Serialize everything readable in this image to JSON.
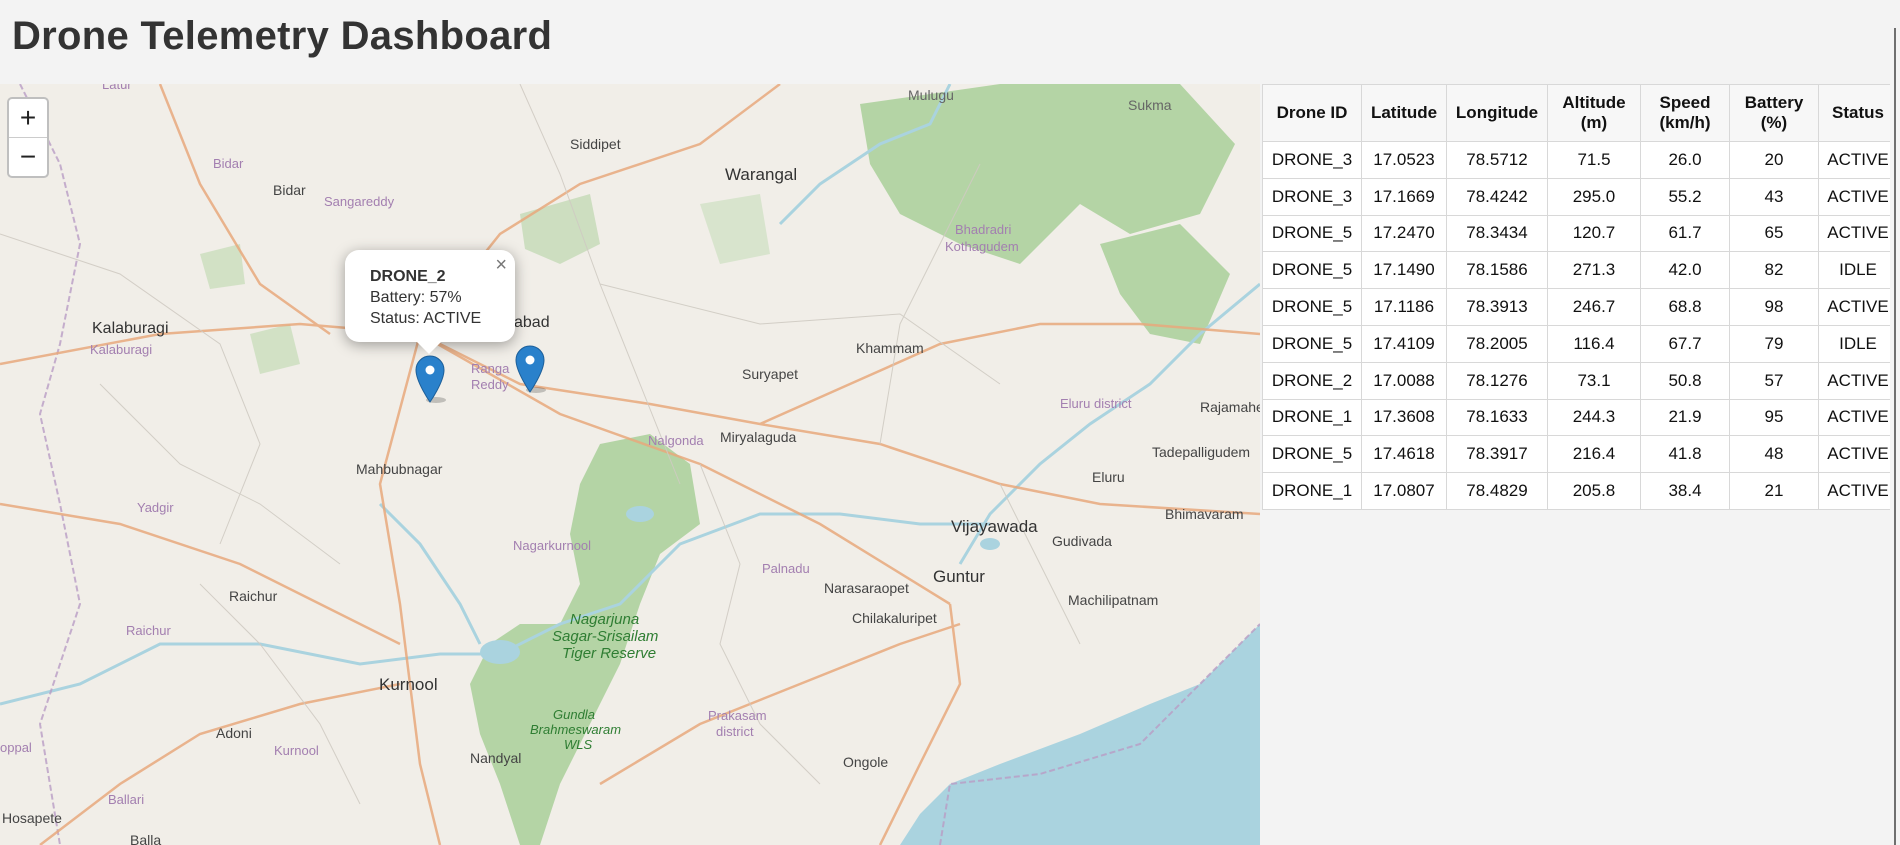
{
  "page": {
    "title": "Drone Telemetry Dashboard"
  },
  "map": {
    "zoom_in_label": "+",
    "zoom_out_label": "−",
    "labels": {
      "latur": "Latur",
      "mulugu": "Mulugu",
      "sukma": "Sukma",
      "bidar_ka": "Bidar",
      "bidar": "Bidar",
      "siddipet": "Siddipet",
      "sangareddy": "Sangareddy",
      "warangal": "Warangal",
      "bhadradri": "Bhadradri",
      "kothagudem": "Kothagudem",
      "kalaburagi": "Kalaburagi",
      "kalaburagi_dist": "Kalaburagi",
      "hyderabad_frag": "abad",
      "ranga": "Ranga",
      "reddy": "Reddy",
      "khammam": "Khammam",
      "suryapet": "Suryapet",
      "eluru_district": "Eluru district",
      "rajamahe": "Rajamahe",
      "nalgonda": "Nalgonda",
      "miryalaguda": "Miryalaguda",
      "mahbubnagar": "Mahbubnagar",
      "tadepalligudem": "Tadepalligudem",
      "eluru": "Eluru",
      "yadgir": "Yadgir",
      "bhimavaram": "Bhimavaram",
      "vijayawada": "Vijayawada",
      "nagarkurnool": "Nagarkurnool",
      "gudivada": "Gudivada",
      "palnadu": "Palnadu",
      "guntur": "Guntur",
      "raichur": "Raichur",
      "narasaraopet": "Narasaraopet",
      "machilipatnam": "Machilipatnam",
      "raichur_dist": "Raichur",
      "chilakaluripet": "Chilakaluripet",
      "nagarjuna1": "Nagarjuna",
      "nagarjuna2": "Sagar-Srisailam",
      "nagarjuna3": "Tiger Reserve",
      "kurnool": "Kurnool",
      "gundla1": "Gundla",
      "gundla2": "Brahmeswaram",
      "gundla3": "WLS",
      "prakasam1": "Prakasam",
      "prakasam2": "district",
      "adoni": "Adoni",
      "kurnool_dist": "Kurnool",
      "nandyal": "Nandyal",
      "koppal": "oppal",
      "ongole": "Ongole",
      "ballari": "Ballari",
      "hosapete": "Hosapete",
      "ballari_frag": "Balla"
    },
    "popup": {
      "title": "DRONE_2",
      "battery": "Battery: 57%",
      "status": "Status: ACTIVE",
      "close": "×"
    },
    "colors": {
      "marker": "#2a81cb",
      "water": "#aad3df",
      "forest": "#add19e"
    }
  },
  "table": {
    "headers": [
      [
        "Drone ID"
      ],
      [
        "Latitude"
      ],
      [
        "Longitude"
      ],
      [
        "Altitude",
        "(m)"
      ],
      [
        "Speed",
        "(km/h)"
      ],
      [
        "Battery",
        "(%)"
      ],
      [
        "Status"
      ]
    ],
    "rows": [
      [
        "DRONE_3",
        "17.0523",
        "78.5712",
        "71.5",
        "26.0",
        "20",
        "ACTIVE"
      ],
      [
        "DRONE_3",
        "17.1669",
        "78.4242",
        "295.0",
        "55.2",
        "43",
        "ACTIVE"
      ],
      [
        "DRONE_5",
        "17.2470",
        "78.3434",
        "120.7",
        "61.7",
        "65",
        "ACTIVE"
      ],
      [
        "DRONE_5",
        "17.1490",
        "78.1586",
        "271.3",
        "42.0",
        "82",
        "IDLE"
      ],
      [
        "DRONE_5",
        "17.1186",
        "78.3913",
        "246.7",
        "68.8",
        "98",
        "ACTIVE"
      ],
      [
        "DRONE_5",
        "17.4109",
        "78.2005",
        "116.4",
        "67.7",
        "79",
        "IDLE"
      ],
      [
        "DRONE_2",
        "17.0088",
        "78.1276",
        "73.1",
        "50.8",
        "57",
        "ACTIVE"
      ],
      [
        "DRONE_1",
        "17.3608",
        "78.1633",
        "244.3",
        "21.9",
        "95",
        "ACTIVE"
      ],
      [
        "DRONE_5",
        "17.4618",
        "78.3917",
        "216.4",
        "41.8",
        "48",
        "ACTIVE"
      ],
      [
        "DRONE_1",
        "17.0807",
        "78.4829",
        "205.8",
        "38.4",
        "21",
        "ACTIVE"
      ]
    ]
  }
}
